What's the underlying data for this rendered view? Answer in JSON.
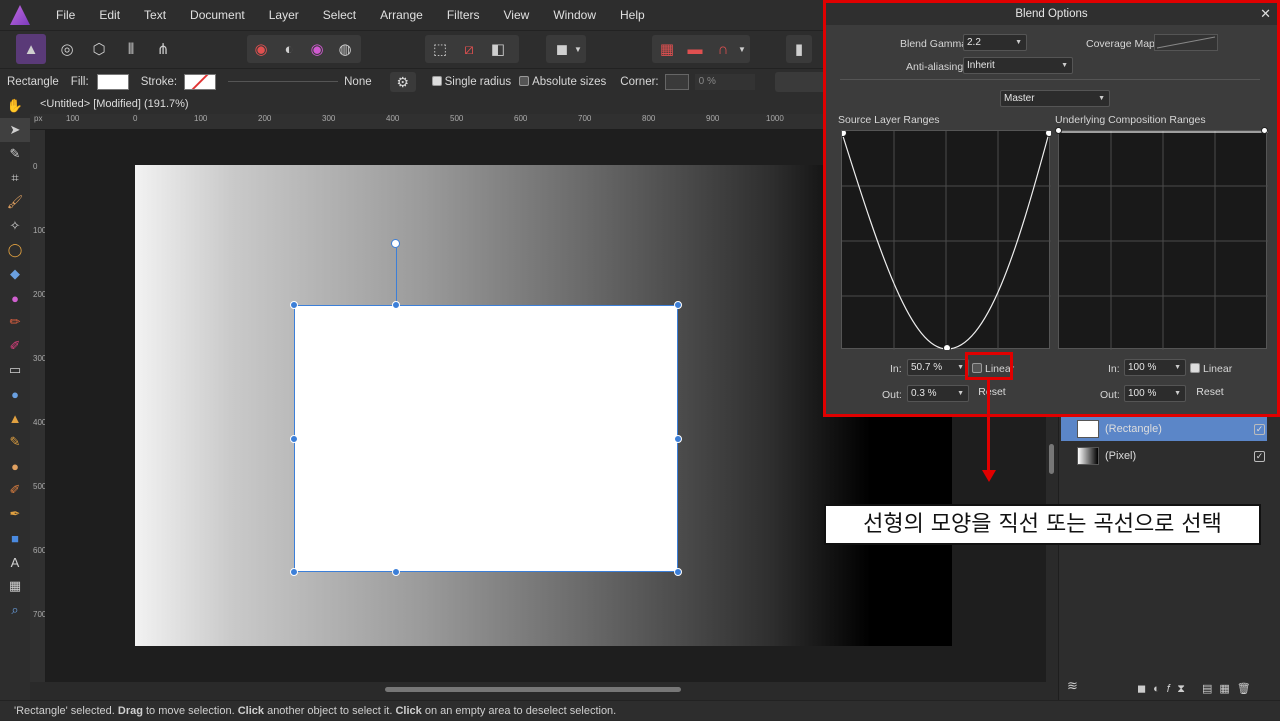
{
  "menu": [
    "File",
    "Edit",
    "Text",
    "Document",
    "Layer",
    "Select",
    "Arrange",
    "Filters",
    "View",
    "Window",
    "Help"
  ],
  "context": {
    "tool_name": "Rectangle",
    "fill_label": "Fill:",
    "stroke_label": "Stroke:",
    "stroke_value": "None",
    "single_radius": "Single radius",
    "absolute_sizes": "Absolute sizes",
    "corner_label": "Corner:",
    "corner_value": "0 %"
  },
  "document": {
    "tab_title": "<Untitled> [Modified] (191.7%)"
  },
  "ruler": {
    "h_ticks": [
      "100",
      "0",
      "100",
      "200",
      "300",
      "400",
      "500",
      "600",
      "700",
      "800",
      "900",
      "1000"
    ],
    "v_ticks": [
      "0",
      "100",
      "200",
      "300",
      "400",
      "500",
      "600",
      "700"
    ],
    "unit": "px"
  },
  "blend_options": {
    "title": "Blend Options",
    "blend_gamma_label": "Blend Gamma:",
    "blend_gamma_value": "2.2",
    "coverage_map_label": "Coverage Map:",
    "anti_aliasing_label": "Anti-aliasing:",
    "anti_aliasing_value": "Inherit",
    "channel_value": "Master",
    "source_title": "Source Layer Ranges",
    "underlying_title": "Underlying Composition Ranges",
    "source": {
      "in_label": "In:",
      "in_value": "50.7 %",
      "out_label": "Out:",
      "out_value": "0.3 %",
      "linear_label": "Linear",
      "reset_label": "Reset"
    },
    "underlying": {
      "in_label": "In:",
      "in_value": "100 %",
      "out_label": "Out:",
      "out_value": "100 %",
      "linear_label": "Linear",
      "reset_label": "Reset"
    }
  },
  "layers": [
    {
      "name": "(Rectangle)",
      "selected": true
    },
    {
      "name": "(Pixel)",
      "selected": false
    }
  ],
  "callout": {
    "text": "선형의 모양을 직선 또는 곡선으로 선택"
  },
  "status": {
    "p1": "'Rectangle' selected. ",
    "b1": "Drag",
    "p2": " to move selection. ",
    "b2": "Click",
    "p3": " another object to select it. ",
    "b3": "Click",
    "p4": " on an empty area to deselect selection."
  },
  "colors": {
    "accent": "#3c7fd8",
    "highlight_red": "#e00000"
  }
}
